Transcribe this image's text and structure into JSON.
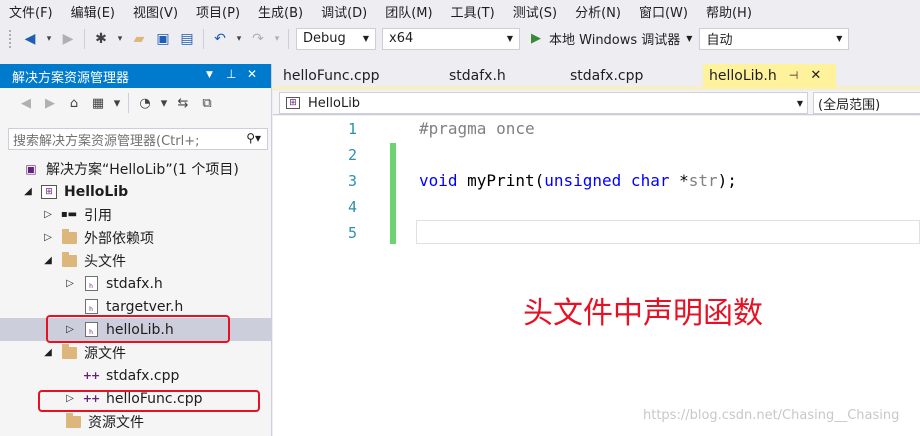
{
  "menu": [
    "文件(F)",
    "编辑(E)",
    "视图(V)",
    "项目(P)",
    "生成(B)",
    "调试(D)",
    "团队(M)",
    "工具(T)",
    "测试(S)",
    "分析(N)",
    "窗口(W)",
    "帮助(H)"
  ],
  "toolbar": {
    "config": "Debug",
    "platform": "x64",
    "run_label": "本地 Windows 调试器",
    "run_mode": "自动"
  },
  "solution_explorer": {
    "title": "解决方案资源管理器",
    "search_placeholder": "搜索解决方案资源管理器(Ctrl+;",
    "tree": [
      {
        "label": "解决方案“HelloLib”(1 个项目)",
        "indent": 0,
        "expander": "",
        "icon": "solution-icon",
        "bold": false,
        "selected": false
      },
      {
        "label": "HelloLib",
        "indent": 1,
        "expander": "◢",
        "icon": "project-icon",
        "bold": true,
        "selected": false
      },
      {
        "label": "引用",
        "indent": 2,
        "expander": "▷",
        "icon": "references-icon",
        "bold": false,
        "selected": false
      },
      {
        "label": "外部依赖项",
        "indent": 2,
        "expander": "▷",
        "icon": "external-deps-icon",
        "bold": false,
        "selected": false
      },
      {
        "label": "头文件",
        "indent": 2,
        "expander": "◢",
        "icon": "folder-icon",
        "bold": false,
        "selected": false
      },
      {
        "label": "stdafx.h",
        "indent": 3,
        "expander": "▷",
        "icon": "header-file-icon",
        "bold": false,
        "selected": false
      },
      {
        "label": "targetver.h",
        "indent": 3,
        "expander": "",
        "icon": "header-file-icon",
        "bold": false,
        "selected": false
      },
      {
        "label": "helloLib.h",
        "indent": 3,
        "expander": "▷",
        "icon": "header-file-icon",
        "bold": false,
        "selected": true
      },
      {
        "label": "源文件",
        "indent": 2,
        "expander": "◢",
        "icon": "folder-icon",
        "bold": false,
        "selected": false
      },
      {
        "label": "stdafx.cpp",
        "indent": 3,
        "expander": "",
        "icon": "cpp-file-icon",
        "bold": false,
        "selected": false
      },
      {
        "label": "helloFunc.cpp",
        "indent": 3,
        "expander": "▷",
        "icon": "cpp-file-icon",
        "bold": false,
        "selected": false
      },
      {
        "label": "资源文件",
        "indent": 2,
        "expander": "",
        "icon": "folder-icon",
        "bold": false,
        "selected": false
      }
    ]
  },
  "editor": {
    "tabs": [
      "helloFunc.cpp",
      "stdafx.h",
      "stdafx.cpp",
      "helloLib.h"
    ],
    "active_tab": "helloLib.h",
    "nav_left": "HelloLib",
    "nav_right": "(全局范围)",
    "line_numbers": [
      "1",
      "2",
      "3",
      "4",
      "5"
    ],
    "code": {
      "l1": "#pragma once",
      "l3_kw1": "void",
      "l3_fn": " myPrint(",
      "l3_kw2": "unsigned char",
      "l3_star": " *",
      "l3_param": "str",
      "l3_end": ");"
    }
  },
  "annotation": "头文件中声明函数",
  "watermark": "https://blog.csdn.net/Chasing__Chasing",
  "colors": {
    "accent": "#007acc",
    "active_tab": "#fff29d",
    "annotation": "#e81123",
    "keyword": "#0000ff",
    "change_bar": "#6bd470"
  }
}
